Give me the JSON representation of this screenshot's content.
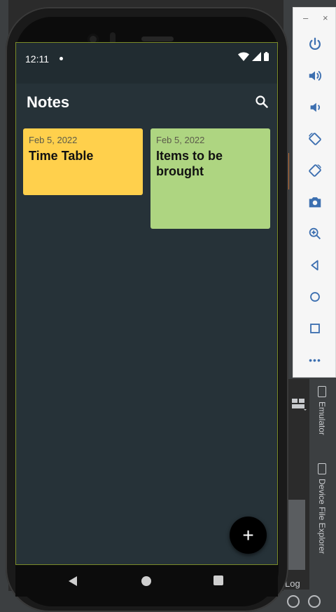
{
  "app": {
    "title": "Notes",
    "fab_label": "+"
  },
  "statusbar": {
    "time": "12:11"
  },
  "notes": [
    {
      "date": "Feb 5, 2022",
      "title": "Time Table",
      "color": "#ffd04c"
    },
    {
      "date": "Feb 5, 2022",
      "title": "Items to be brought",
      "color": "#aed581"
    }
  ],
  "emulator_panel": {
    "minimize": "–",
    "close": "×",
    "buttons": [
      "power-icon",
      "volume-up-icon",
      "volume-down-icon",
      "rotate-left-icon",
      "rotate-right-icon",
      "camera-icon",
      "zoom-icon",
      "back-icon",
      "home-icon",
      "overview-icon",
      "more-icon"
    ],
    "more_label": "•••"
  },
  "ide": {
    "tool_emulator": "Emulator",
    "tool_device_file_explorer": "Device File Explorer",
    "log_label": "Log"
  },
  "colors": {
    "screen_bg": "#263238",
    "statusbar_bg": "#212c31",
    "accent_border": "#7a8a28"
  }
}
